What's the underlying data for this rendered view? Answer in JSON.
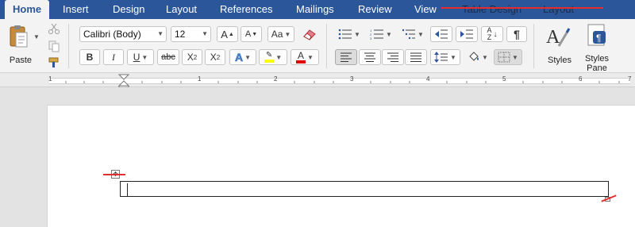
{
  "tabs": {
    "home": "Home",
    "insert": "Insert",
    "design": "Design",
    "layout": "Layout",
    "references": "References",
    "mailings": "Mailings",
    "review": "Review",
    "view": "View",
    "table_design": "Table Design",
    "table_layout": "Layout"
  },
  "clipboard": {
    "paste_label": "Paste"
  },
  "font": {
    "name": "Calibri (Body)",
    "size": "12"
  },
  "formatting": {
    "bold": "B",
    "italic": "I",
    "underline": "U",
    "strikethrough": "abc",
    "subscript_base": "X",
    "subscript_mark": "2",
    "superscript_base": "X",
    "superscript_mark": "2",
    "grow_font": "A",
    "shrink_font": "A",
    "change_case": "Aa",
    "text_effects": "A",
    "font_color": "A",
    "highlight": "ab"
  },
  "paragraph": {
    "show_marks": "¶"
  },
  "styles": {
    "styles_label": "Styles",
    "styles_pane_label": "Styles Pane"
  },
  "ruler": {
    "numbers": [
      "1",
      "1",
      "2",
      "3",
      "4",
      "5",
      "6",
      "7"
    ]
  },
  "colors": {
    "tab_bar": "#2b579a",
    "annotation_red": "#e52d2d",
    "highlight_yellow": "#ffff00",
    "font_color_red": "#e00000",
    "accent_blue": "#2b579a"
  },
  "icons": {
    "paste": "clipboard-icon",
    "cut": "scissors-icon",
    "copy": "copy-icon",
    "format_painter": "paintbrush-icon",
    "clear_format": "eraser-icon",
    "styles": "styles-brush-icon",
    "styles_pane": "styles-pane-icon"
  }
}
